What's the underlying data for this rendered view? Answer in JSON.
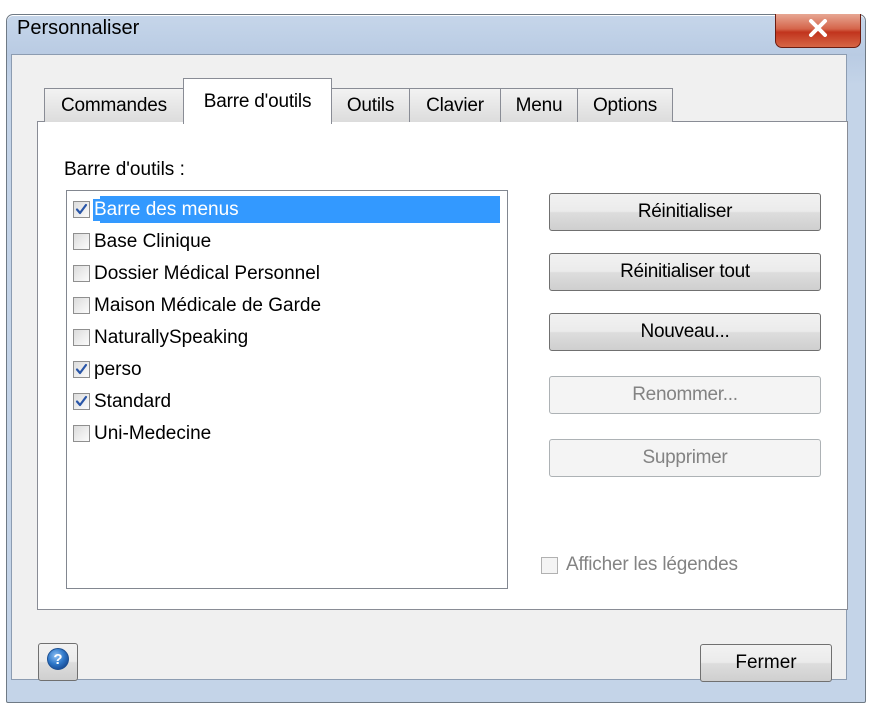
{
  "window": {
    "title": "Personnaliser",
    "close_icon": "close-icon"
  },
  "tabs": [
    {
      "label": "Commandes",
      "active": false
    },
    {
      "label": "Barre d'outils",
      "active": true
    },
    {
      "label": "Outils",
      "active": false
    },
    {
      "label": "Clavier",
      "active": false
    },
    {
      "label": "Menu",
      "active": false
    },
    {
      "label": "Options",
      "active": false
    }
  ],
  "toolbars": {
    "label": "Barre d'outils :",
    "items": [
      {
        "label": "Barre des menus",
        "checked": true,
        "selected": true
      },
      {
        "label": "Base Clinique",
        "checked": false,
        "selected": false
      },
      {
        "label": "Dossier Médical Personnel",
        "checked": false,
        "selected": false
      },
      {
        "label": "Maison Médicale de Garde",
        "checked": false,
        "selected": false
      },
      {
        "label": "NaturallySpeaking",
        "checked": false,
        "selected": false
      },
      {
        "label": "perso",
        "checked": true,
        "selected": false
      },
      {
        "label": "Standard",
        "checked": true,
        "selected": false
      },
      {
        "label": "Uni-Medecine",
        "checked": false,
        "selected": false
      }
    ]
  },
  "buttons": {
    "reset": {
      "label": "Réinitialiser",
      "enabled": true
    },
    "reset_all": {
      "label": "Réinitialiser tout",
      "enabled": true
    },
    "new": {
      "label": "Nouveau...",
      "enabled": true
    },
    "rename": {
      "label": "Renommer...",
      "enabled": false
    },
    "delete": {
      "label": "Supprimer",
      "enabled": false
    }
  },
  "show_captions": {
    "label": "Afficher les légendes",
    "checked": false,
    "enabled": false
  },
  "footer": {
    "help_icon": "help-icon",
    "close_label": "Fermer"
  },
  "colors": {
    "selection": "#3399ff",
    "title_close": "#c1341d",
    "disabled_text": "#838383"
  }
}
